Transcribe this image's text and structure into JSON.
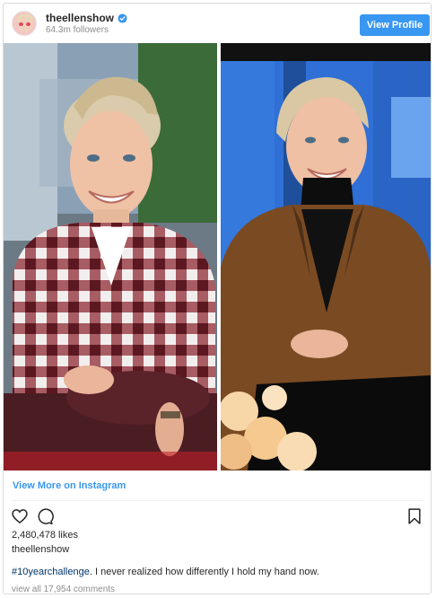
{
  "header": {
    "username": "theellenshow",
    "followers": "64.3m followers",
    "view_profile_label": "View Profile"
  },
  "media": {
    "images": [
      "left-photo",
      "right-photo"
    ]
  },
  "view_more_label": "View More on Instagram",
  "actions": {
    "icons": [
      "heart-icon",
      "comment-icon",
      "bookmark-icon"
    ]
  },
  "post": {
    "likes": "2,480,478 likes",
    "owner": "theellenshow",
    "hashtag": "#10yearchallenge",
    "caption_text": ". I never realized how differently I hold my hand now.",
    "comments": "view all 17,954 comments"
  },
  "colors": {
    "accent": "#3897f0",
    "text": "#262626",
    "muted": "#8e8e8e",
    "hashtag": "#003569"
  }
}
